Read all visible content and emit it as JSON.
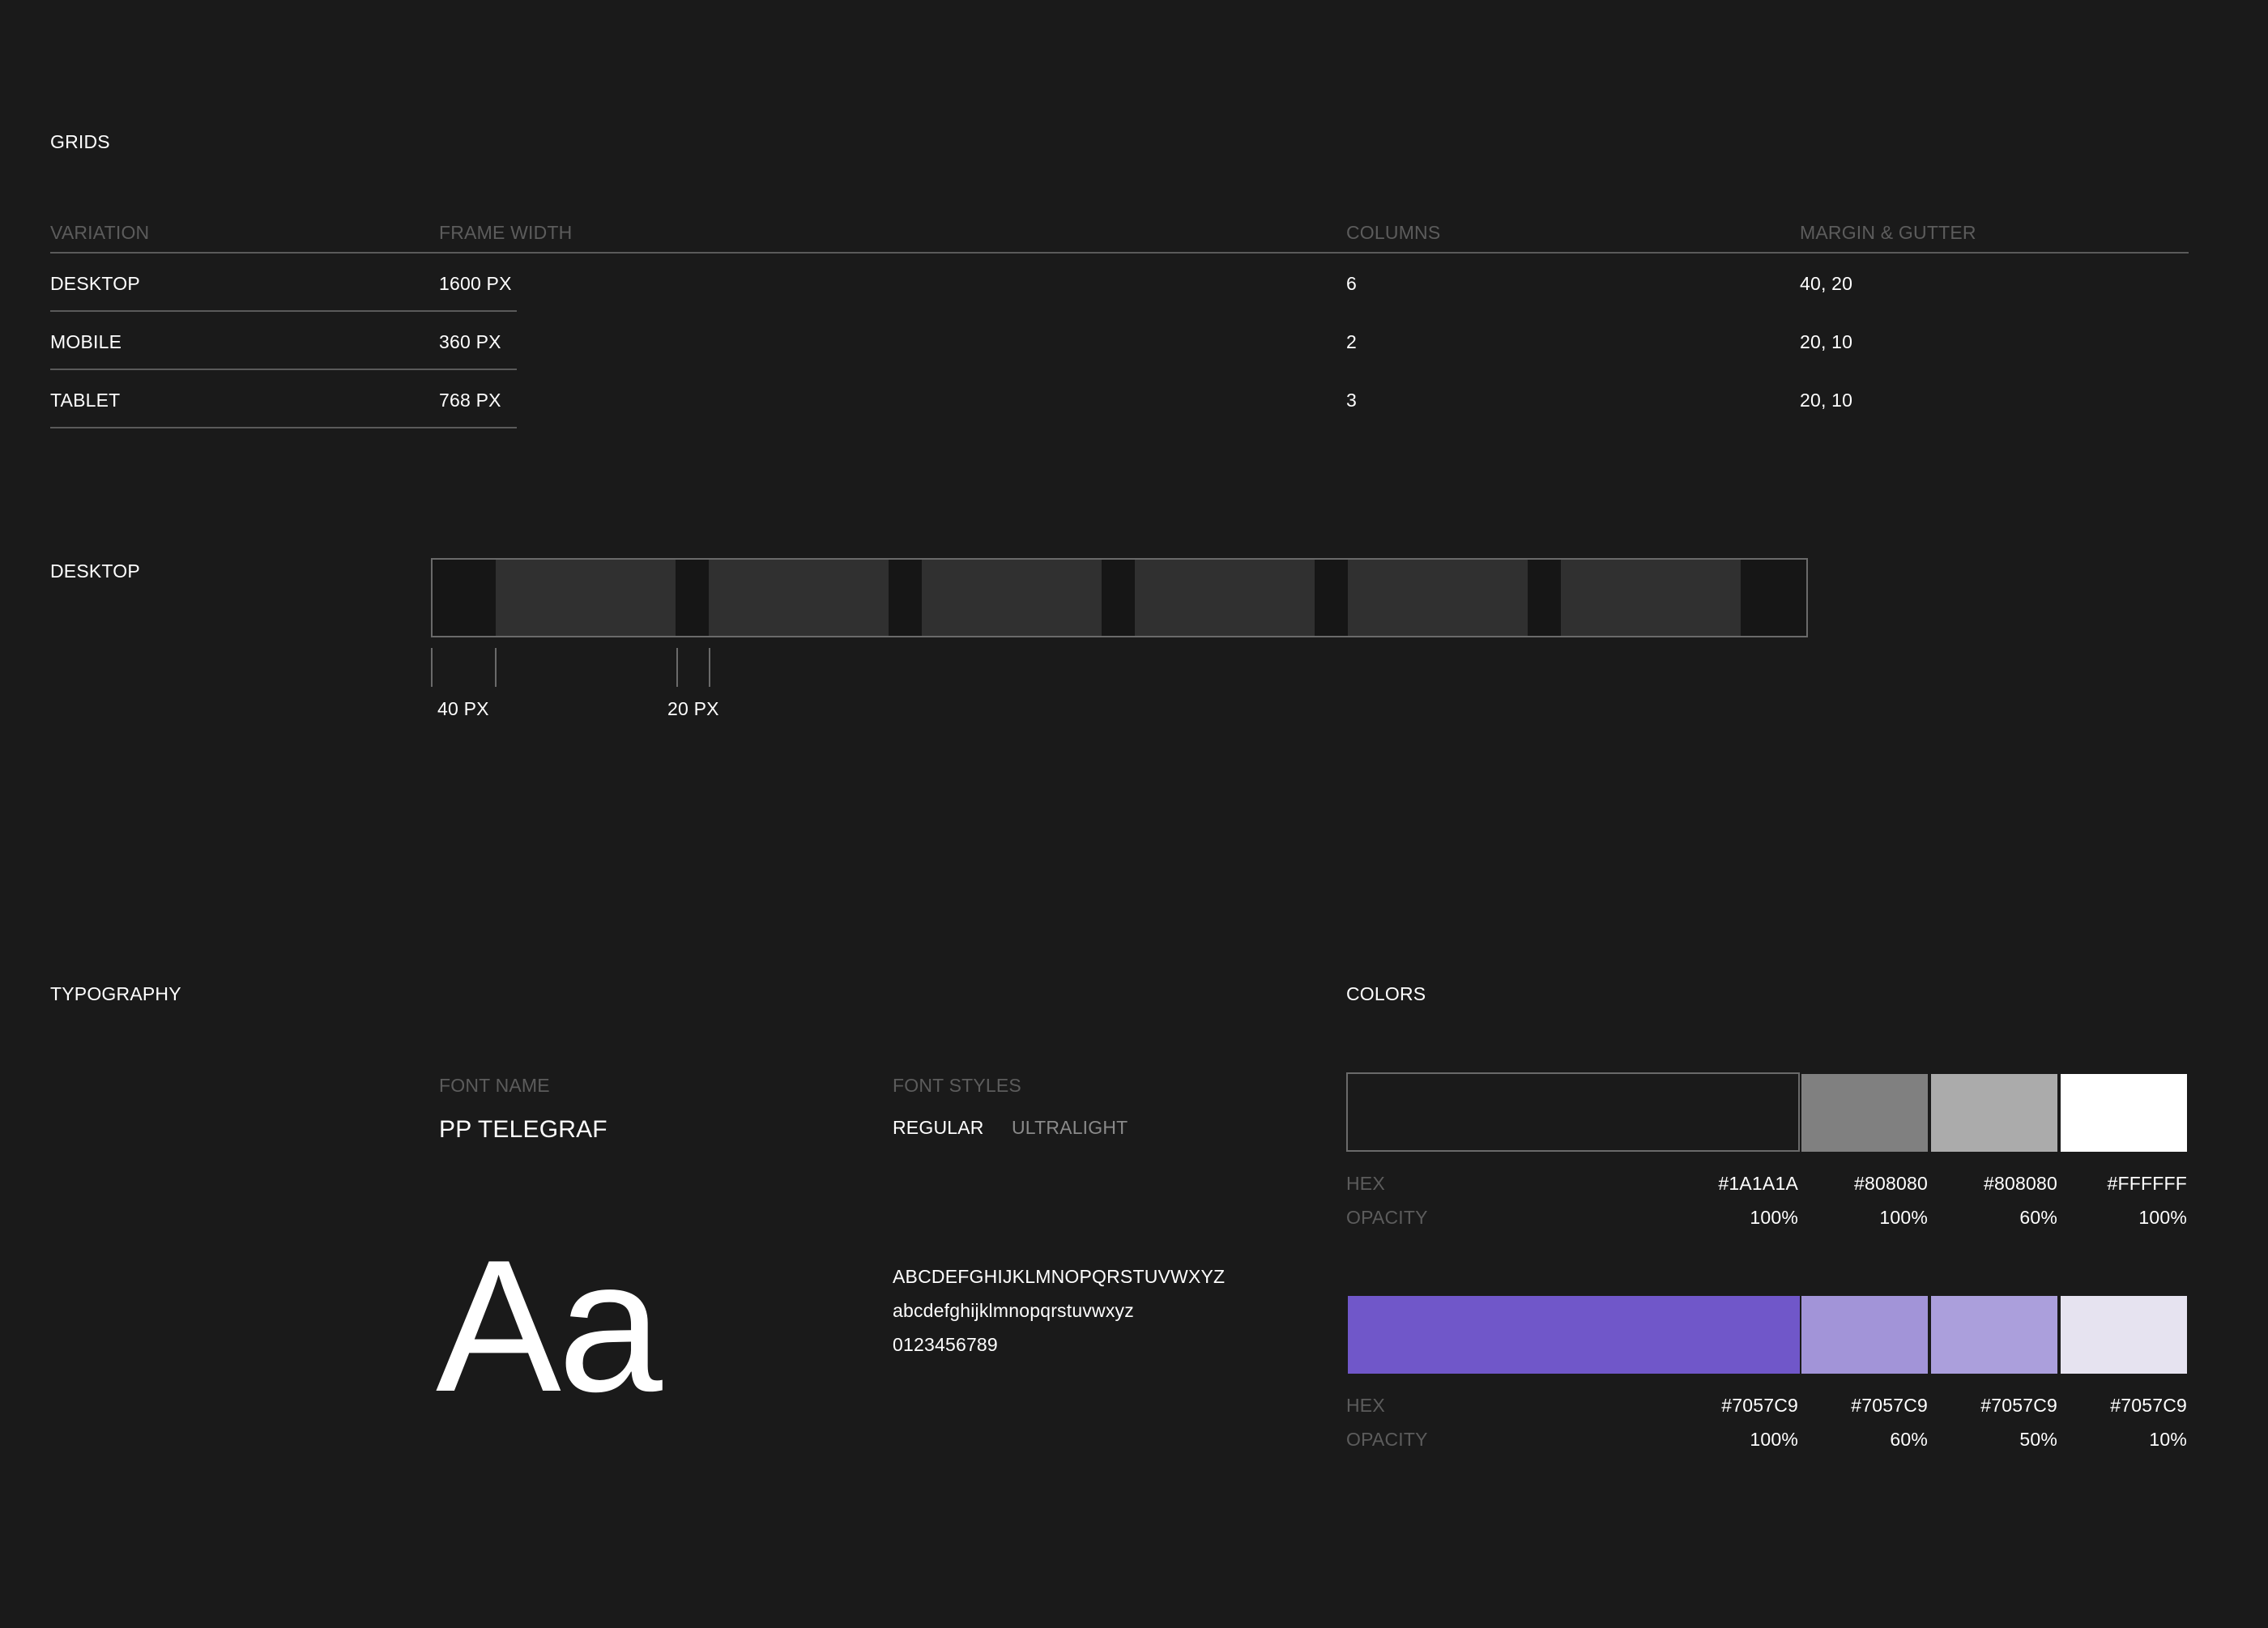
{
  "grids": {
    "title": "GRIDS",
    "headers": [
      "VARIATION",
      "FRAME WIDTH",
      "COLUMNS",
      "MARGIN & GUTTER"
    ],
    "rows": [
      {
        "variation": "DESKTOP",
        "frame_width": "1600 PX",
        "columns": "6",
        "margin_gutter": "40, 20"
      },
      {
        "variation": "MOBILE",
        "frame_width": "360 PX",
        "columns": "2",
        "margin_gutter": "20, 10"
      },
      {
        "variation": "TABLET",
        "frame_width": "768 PX",
        "columns": "3",
        "margin_gutter": "20, 10"
      }
    ]
  },
  "desktop_grid": {
    "label": "DESKTOP",
    "columns": 6,
    "margin_label": "40 PX",
    "gutter_label": "20 PX"
  },
  "typography": {
    "title": "TYPOGRAPHY",
    "font_name_label": "FONT NAME",
    "font_name": "PP TELEGRAF",
    "font_styles_label": "FONT STYLES",
    "styles": [
      "REGULAR",
      "ULTRALIGHT"
    ],
    "specimen": "Aa",
    "uppercase": "ABCDEFGHIJKLMNOPQRSTUVWXYZ",
    "lowercase": "abcdefghijklmnopqrstuvwxyz",
    "digits": "0123456789"
  },
  "colors": {
    "title": "COLORS",
    "hex_label": "HEX",
    "opacity_label": "OPACITY",
    "palettes": [
      {
        "swatches": [
          {
            "hex": "#1A1A1A",
            "opacity": "100%",
            "color": "#1a1a1a"
          },
          {
            "hex": "#808080",
            "opacity": "100%",
            "color": "#808080"
          },
          {
            "hex": "#808080",
            "opacity": "60%",
            "color": "#ababab"
          },
          {
            "hex": "#FFFFFF",
            "opacity": "100%",
            "color": "#ffffff"
          }
        ]
      },
      {
        "swatches": [
          {
            "hex": "#7057C9",
            "opacity": "100%",
            "color": "#7057c9"
          },
          {
            "hex": "#7057C9",
            "opacity": "60%",
            "color": "#a294d8"
          },
          {
            "hex": "#7057C9",
            "opacity": "50%",
            "color": "#ab9fdc"
          },
          {
            "hex": "#7057C9",
            "opacity": "10%",
            "color": "#e6e3f0"
          }
        ]
      }
    ]
  }
}
